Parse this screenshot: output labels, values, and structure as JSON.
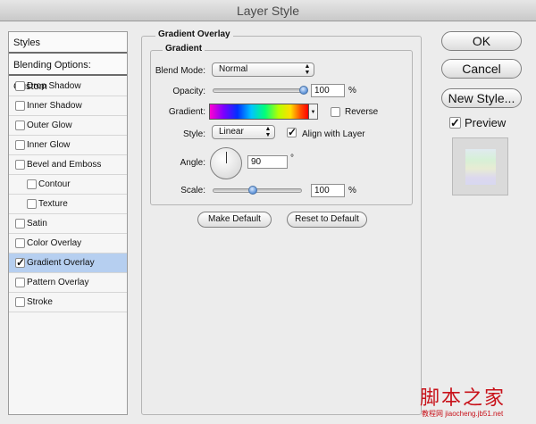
{
  "window": {
    "title": "Layer Style"
  },
  "sidebar": {
    "styles_header": "Styles",
    "blending_header": "Blending Options: Custom",
    "items": [
      {
        "label": "Drop Shadow",
        "checked": false,
        "selected": false,
        "sub": false
      },
      {
        "label": "Inner Shadow",
        "checked": false,
        "selected": false,
        "sub": false
      },
      {
        "label": "Outer Glow",
        "checked": false,
        "selected": false,
        "sub": false
      },
      {
        "label": "Inner Glow",
        "checked": false,
        "selected": false,
        "sub": false
      },
      {
        "label": "Bevel and Emboss",
        "checked": false,
        "selected": false,
        "sub": false
      },
      {
        "label": "Contour",
        "checked": false,
        "selected": false,
        "sub": true
      },
      {
        "label": "Texture",
        "checked": false,
        "selected": false,
        "sub": true
      },
      {
        "label": "Satin",
        "checked": false,
        "selected": false,
        "sub": false
      },
      {
        "label": "Color Overlay",
        "checked": false,
        "selected": false,
        "sub": false
      },
      {
        "label": "Gradient Overlay",
        "checked": true,
        "selected": true,
        "sub": false
      },
      {
        "label": "Pattern Overlay",
        "checked": false,
        "selected": false,
        "sub": false
      },
      {
        "label": "Stroke",
        "checked": false,
        "selected": false,
        "sub": false
      }
    ]
  },
  "panel": {
    "group_title": "Gradient Overlay",
    "inner_group_title": "Gradient",
    "blend_mode_label": "Blend Mode:",
    "blend_mode_value": "Normal",
    "opacity_label": "Opacity:",
    "opacity_value": "100",
    "opacity_slider_percent": 100,
    "percent_unit": "%",
    "gradient_label": "Gradient:",
    "reverse_label": "Reverse",
    "reverse_checked": false,
    "style_label": "Style:",
    "style_value": "Linear",
    "align_label": "Align with Layer",
    "align_checked": true,
    "angle_label": "Angle:",
    "angle_value": "90",
    "degree_unit": "°",
    "scale_label": "Scale:",
    "scale_value": "100",
    "scale_slider_percent": 44,
    "make_default": "Make Default",
    "reset_default": "Reset to Default"
  },
  "actions": {
    "ok": "OK",
    "cancel": "Cancel",
    "new_style": "New Style...",
    "preview_label": "Preview",
    "preview_checked": true
  },
  "watermark": {
    "main": "脚本之家",
    "sub": "教程网 jiaocheng.jb51.net"
  },
  "colors": {
    "selected_row": "#b6cff0",
    "watermark": "#c8121a"
  }
}
